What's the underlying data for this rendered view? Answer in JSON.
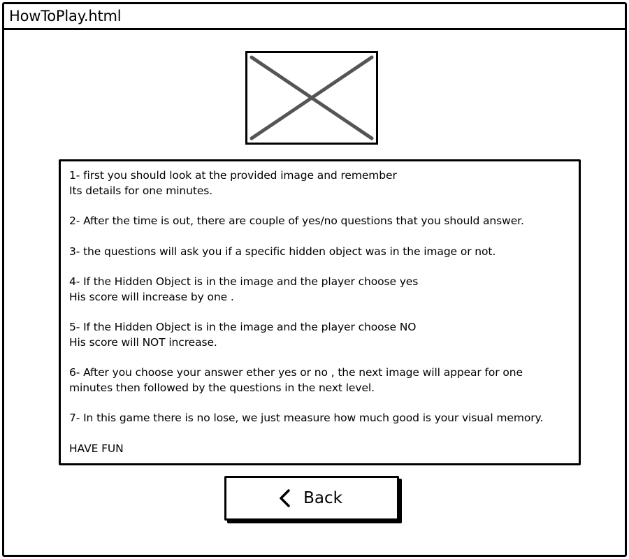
{
  "window": {
    "title": "HowToPlay.html"
  },
  "image_placeholder": {
    "icon": "image-placeholder-icon",
    "stroke_color": "#555555"
  },
  "instructions": {
    "items": [
      {
        "lines": [
          "1- first you should look at the provided image and remember",
          "Its details for one minutes."
        ]
      },
      {
        "lines": [
          "2- After the time is out, there are couple of yes/no questions that you should answer."
        ]
      },
      {
        "lines": [
          "3- the questions will ask you if a specific hidden object was in the image or not."
        ]
      },
      {
        "lines": [
          "4- If the Hidden Object is in the image and the player choose yes",
          "His score will increase by one ."
        ]
      },
      {
        "lines": [
          "5- If the Hidden Object is in the image and the player choose NO",
          "His score will NOT increase."
        ]
      },
      {
        "lines": [
          "6- After you choose your answer ether yes or no , the next image will appear for one",
          "minutes then followed by the questions in the next level."
        ]
      },
      {
        "lines": [
          "7- In this game there is no lose, we just measure how much good is your visual memory."
        ]
      },
      {
        "lines": [
          "HAVE FUN"
        ]
      }
    ]
  },
  "back_button": {
    "label": "Back",
    "icon": "chevron-left-icon"
  }
}
